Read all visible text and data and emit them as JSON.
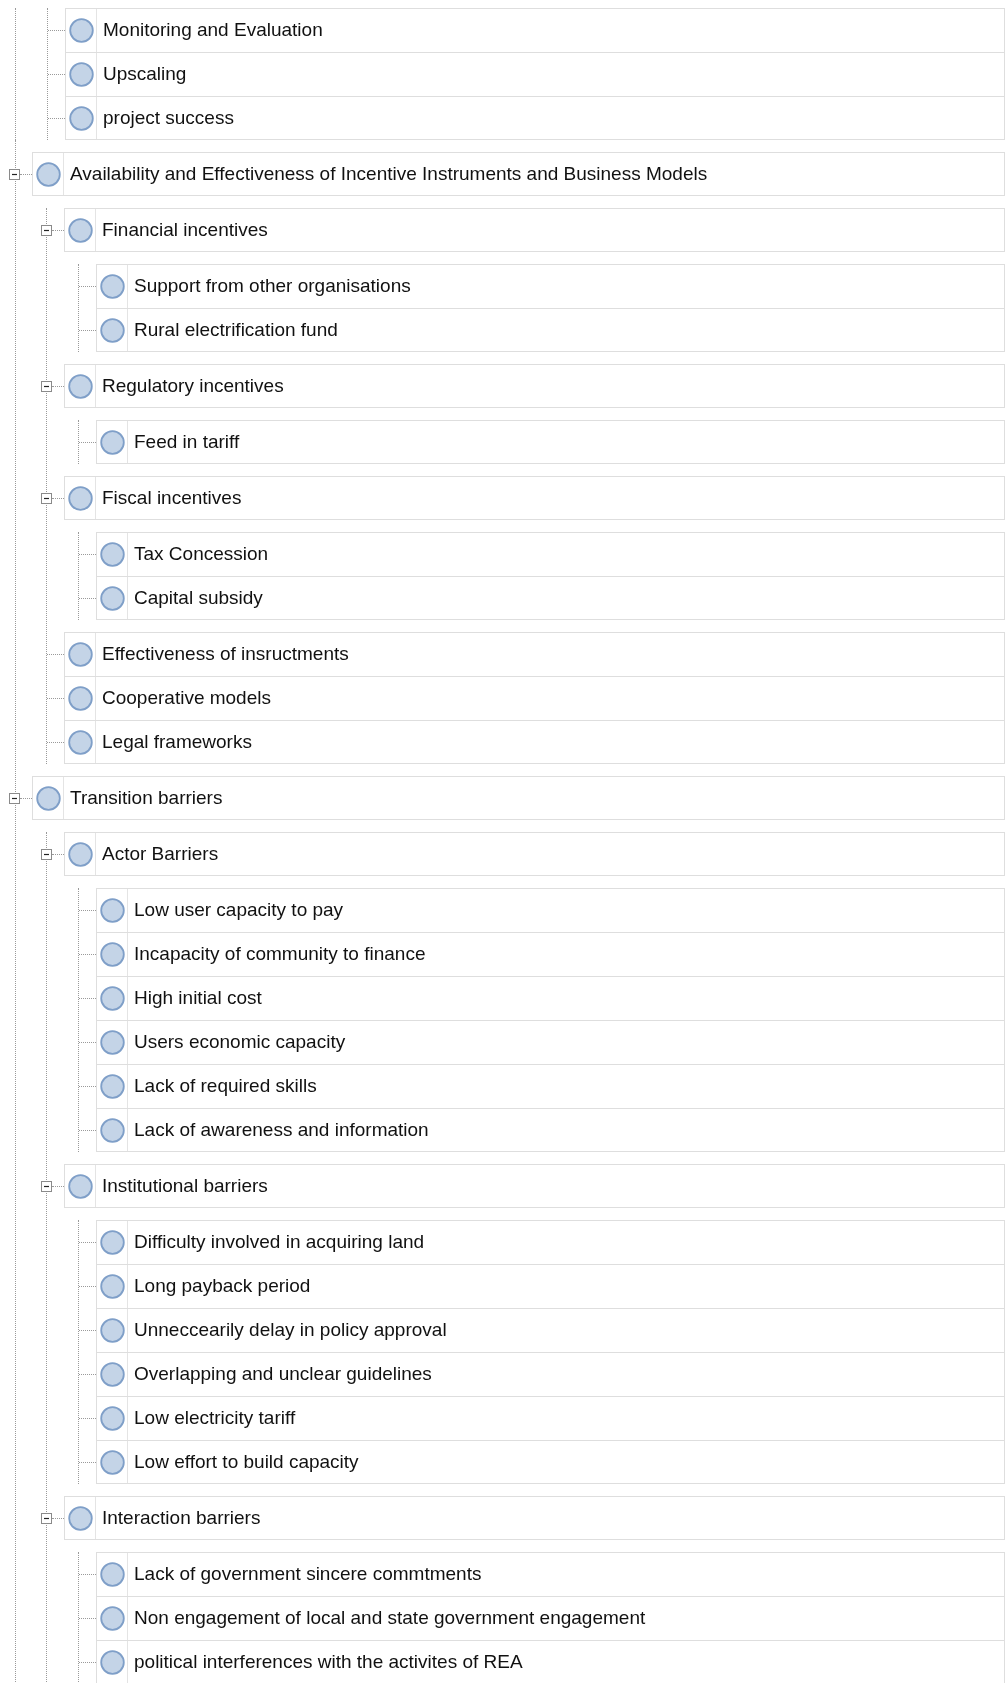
{
  "tree": {
    "continued_children": [
      {
        "label": "Monitoring and Evaluation"
      },
      {
        "label": "Upscaling"
      },
      {
        "label": "project success"
      }
    ],
    "nodes": [
      {
        "label": "Availability and Effectiveness of Incentive Instruments and Business Models",
        "expanded": true,
        "children": [
          {
            "label": "Financial incentives",
            "expanded": true,
            "children": [
              {
                "label": "Support from other organisations"
              },
              {
                "label": "Rural electrification fund"
              }
            ]
          },
          {
            "label": "Regulatory incentives",
            "expanded": true,
            "children": [
              {
                "label": "Feed in tariff"
              }
            ]
          },
          {
            "label": "Fiscal incentives",
            "expanded": true,
            "children": [
              {
                "label": "Tax Concession"
              },
              {
                "label": "Capital subsidy"
              }
            ]
          },
          {
            "label": "Effectiveness of insructments"
          },
          {
            "label": "Cooperative models"
          },
          {
            "label": "Legal frameworks"
          }
        ]
      },
      {
        "label": "Transition barriers",
        "expanded": true,
        "children": [
          {
            "label": "Actor Barriers",
            "expanded": true,
            "children": [
              {
                "label": "Low user capacity to pay"
              },
              {
                "label": "Incapacity of community to finance"
              },
              {
                "label": "High initial cost"
              },
              {
                "label": "Users economic capacity"
              },
              {
                "label": "Lack of required skills"
              },
              {
                "label": "Lack of awareness and information"
              }
            ]
          },
          {
            "label": "Institutional barriers",
            "expanded": true,
            "children": [
              {
                "label": "Difficulty involved in acquiring land"
              },
              {
                "label": "Long payback period"
              },
              {
                "label": "Unneccearily delay in policy approval"
              },
              {
                "label": "Overlapping and unclear guidelines"
              },
              {
                "label": "Low electricity tariff"
              },
              {
                "label": "Low effort to build capacity"
              }
            ]
          },
          {
            "label": "Interaction barriers",
            "expanded": true,
            "children": [
              {
                "label": "Lack of government sincere commtments"
              },
              {
                "label": "Non engagement of local and state government engagement"
              },
              {
                "label": "political interferences with the activites of REA"
              }
            ]
          }
        ]
      }
    ]
  }
}
